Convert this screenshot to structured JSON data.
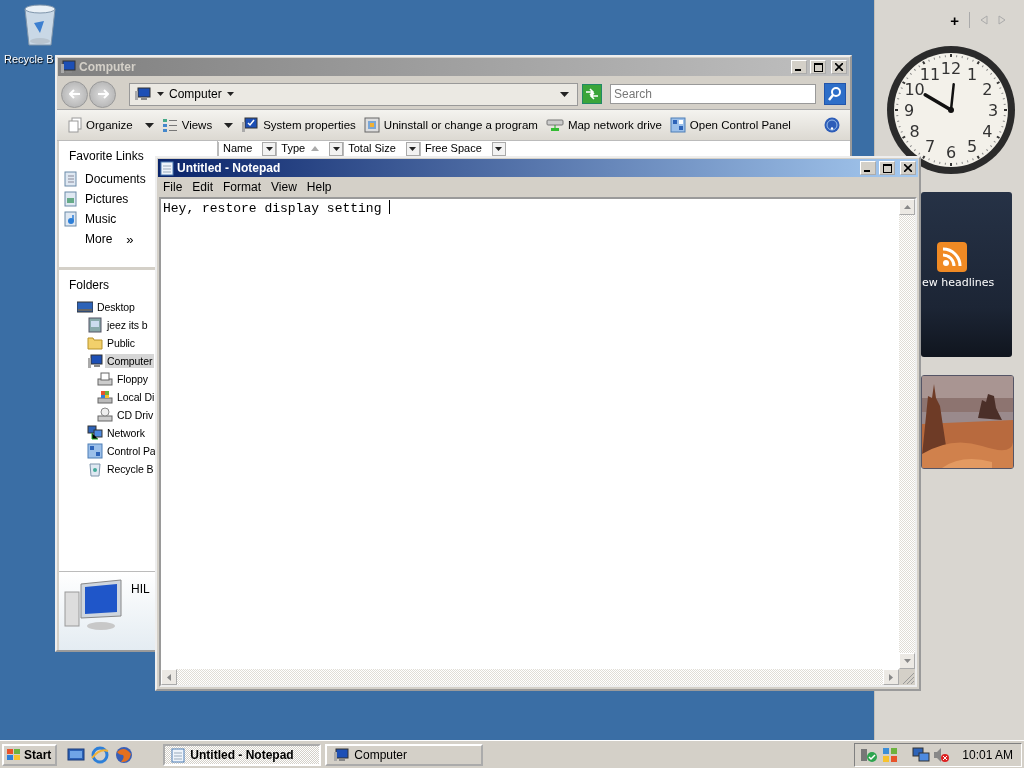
{
  "desktop_icons": [
    {
      "label": "Recycle B"
    }
  ],
  "explorer": {
    "title": "Computer",
    "active": false,
    "address": "Computer",
    "search": {
      "placeholder": "Search"
    },
    "toolbar": [
      {
        "label": "Organize",
        "kind": "organize",
        "dropdown": true
      },
      {
        "label": "Views",
        "kind": "views",
        "dropdown": true
      },
      {
        "label": "System properties",
        "kind": "system",
        "dropdown": false
      },
      {
        "label": "Uninstall or change a program",
        "kind": "programs",
        "dropdown": false
      },
      {
        "label": "Map network drive",
        "kind": "drive",
        "dropdown": false
      },
      {
        "label": "Open Control Panel",
        "kind": "panel",
        "dropdown": false
      }
    ],
    "columns": [
      {
        "label": "Name",
        "sorted": false
      },
      {
        "label": "Type",
        "sorted": true
      },
      {
        "label": "Total Size",
        "sorted": false
      },
      {
        "label": "Free Space",
        "sorted": false
      }
    ],
    "favorite_links": {
      "title": "Favorite Links",
      "items": [
        {
          "label": "Documents",
          "kind": "documents"
        },
        {
          "label": "Pictures",
          "kind": "pictures"
        },
        {
          "label": "Music",
          "kind": "music"
        }
      ],
      "more": "More",
      "more_glyph": "»"
    },
    "folders": {
      "title": "Folders",
      "tree": [
        {
          "label": "Desktop",
          "kind": "desktop",
          "selected": false,
          "children": [
            {
              "label": "jeez its b",
              "kind": "file",
              "selected": false
            },
            {
              "label": "Public",
              "kind": "folder",
              "selected": false
            },
            {
              "label": "Computer",
              "kind": "computer",
              "selected": true,
              "children": [
                {
                  "label": "Floppy",
                  "kind": "floppy",
                  "selected": false
                },
                {
                  "label": "Local Di",
                  "kind": "disk",
                  "selected": false
                },
                {
                  "label": "CD Driv",
                  "kind": "cd",
                  "selected": false
                }
              ]
            },
            {
              "label": "Network",
              "kind": "network",
              "selected": false
            },
            {
              "label": "Control Pa",
              "kind": "panel",
              "selected": false
            },
            {
              "label": "Recycle B",
              "kind": "bin",
              "selected": false
            }
          ]
        }
      ]
    },
    "details": {
      "text": "HIL"
    }
  },
  "notepad": {
    "title": "Untitled - Notepad",
    "active": true,
    "menu": [
      "File",
      "Edit",
      "Format",
      "View",
      "Help"
    ],
    "text": "Hey, restore display setting "
  },
  "sidebar": {
    "add": "+",
    "clock": {
      "numerals": [
        "12",
        "11",
        "1",
        "10",
        "2",
        "9",
        "3",
        "8",
        "4",
        "7",
        "5",
        "6"
      ]
    },
    "news": {
      "label": "ew headlines"
    }
  },
  "taskbar": {
    "start": "Start",
    "tasks": [
      {
        "label": "Untitled - Notepad",
        "kind": "notepad",
        "selected": true
      },
      {
        "label": "Computer",
        "kind": "computer",
        "selected": false
      }
    ],
    "clock": "10:01 AM"
  }
}
